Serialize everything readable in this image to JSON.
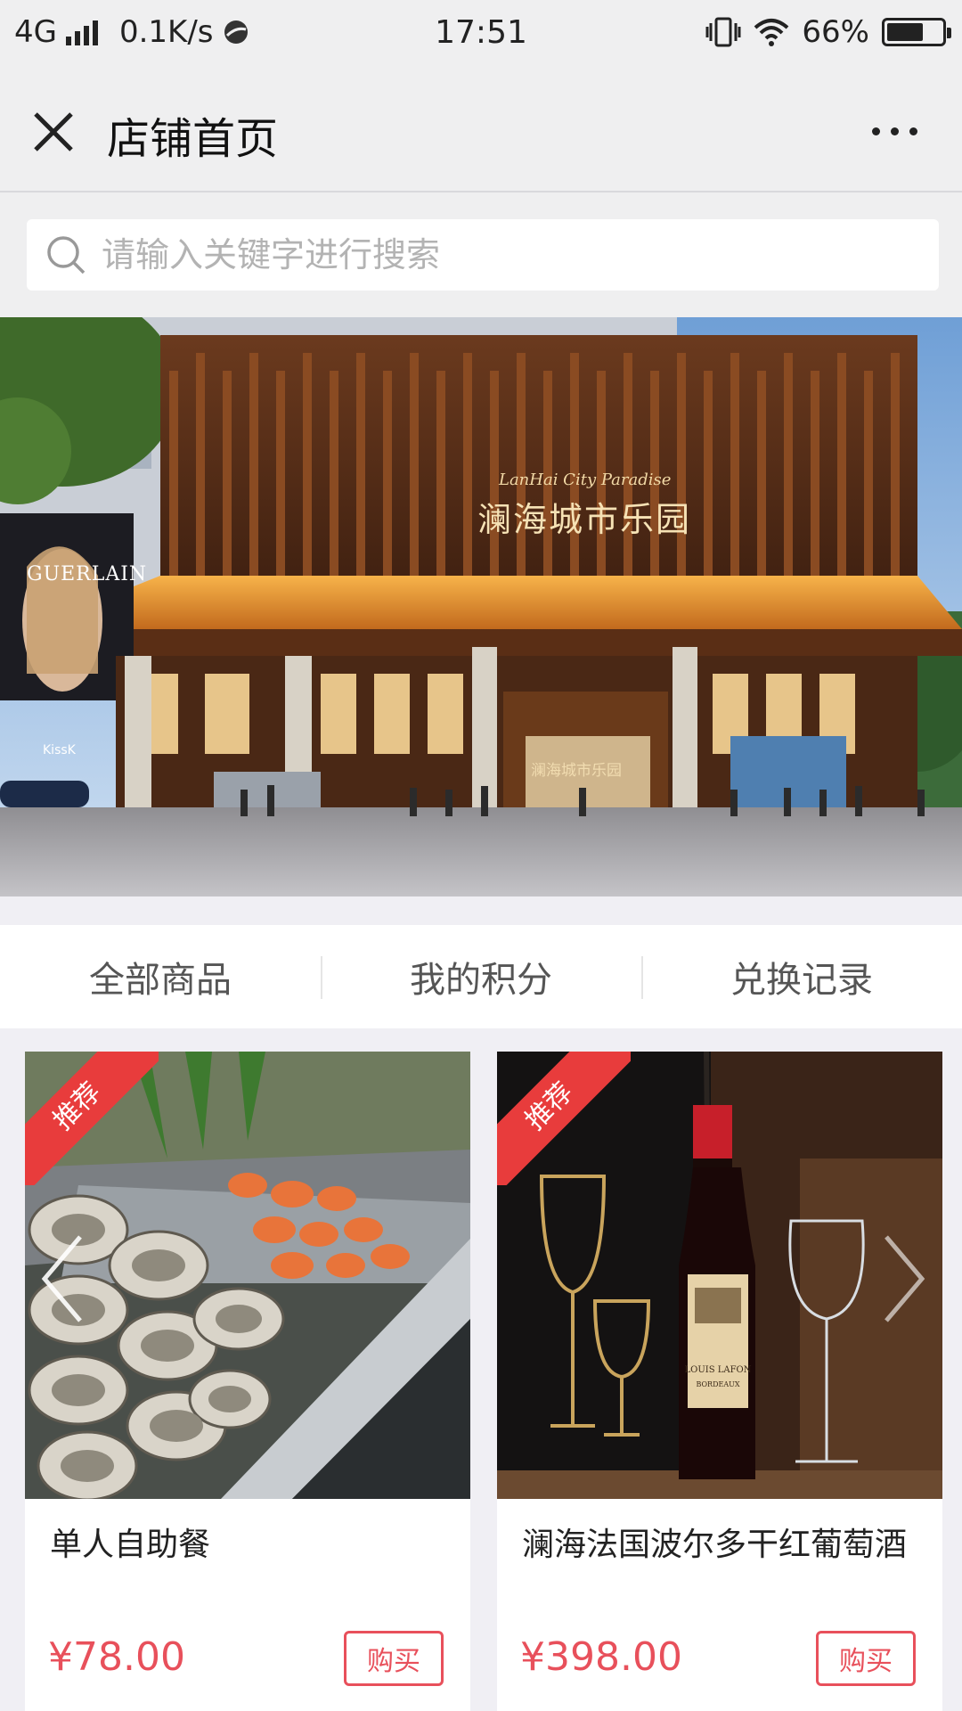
{
  "status_bar": {
    "network": "4G",
    "speed": "0.1K/s",
    "time": "17:51",
    "battery": "66%",
    "battery_level": 0.66
  },
  "nav": {
    "title": "店铺首页"
  },
  "search": {
    "placeholder": "请输入关键字进行搜索"
  },
  "banner": {
    "sign_en": "LanHai City Paradise",
    "sign_cn": "澜海城市乐园",
    "door_sign": "澜海城市乐园",
    "ad_brand": "GUERLAIN",
    "ad_sub": "KissK"
  },
  "tabs": [
    {
      "label": "全部商品"
    },
    {
      "label": "我的积分"
    },
    {
      "label": "兑换记录"
    }
  ],
  "products": [
    {
      "badge": "推荐",
      "title": "单人自助餐",
      "price": "¥78.00",
      "buy_label": "购买"
    },
    {
      "badge": "推荐",
      "title": "澜海法国波尔多干红葡萄酒",
      "price": "¥398.00",
      "buy_label": "购买"
    }
  ],
  "wine_label": {
    "brand": "LOUIS LAFON",
    "region": "BORDEAUX"
  },
  "colors": {
    "accent": "#e8505b",
    "badge": "#e83c3c"
  }
}
